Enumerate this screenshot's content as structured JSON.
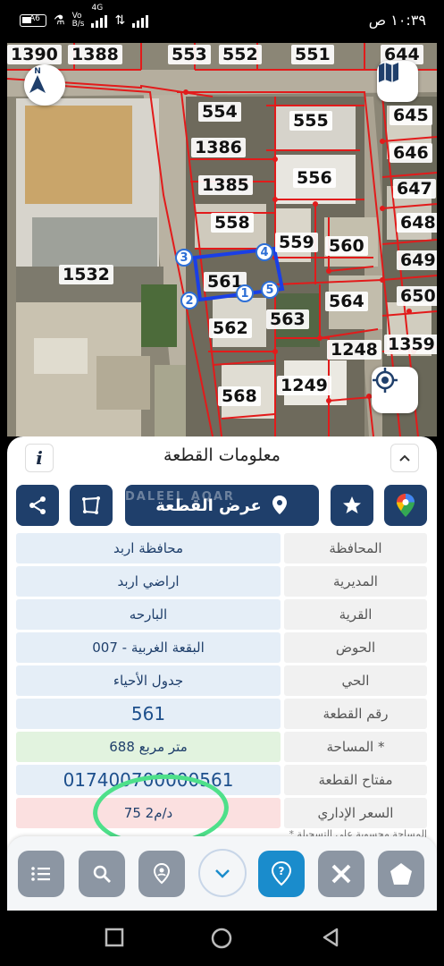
{
  "status_bar": {
    "time": "١٠:٣٩ ص",
    "battery": "A6",
    "network_speed_value": "Vo",
    "network_speed_unit": "B/s",
    "network_type": "4G"
  },
  "map": {
    "parcels": [
      {
        "id": "1390"
      },
      {
        "id": "1388"
      },
      {
        "id": "553"
      },
      {
        "id": "552"
      },
      {
        "id": "551"
      },
      {
        "id": "644"
      },
      {
        "id": "554"
      },
      {
        "id": "555"
      },
      {
        "id": "645"
      },
      {
        "id": "1386"
      },
      {
        "id": "646"
      },
      {
        "id": "1385"
      },
      {
        "id": "556"
      },
      {
        "id": "647"
      },
      {
        "id": "558"
      },
      {
        "id": "648"
      },
      {
        "id": "559"
      },
      {
        "id": "560"
      },
      {
        "id": "649"
      },
      {
        "id": "1532"
      },
      {
        "id": "561"
      },
      {
        "id": "650"
      },
      {
        "id": "564"
      },
      {
        "id": "562"
      },
      {
        "id": "563"
      },
      {
        "id": "1359"
      },
      {
        "id": "1248"
      },
      {
        "id": "568"
      },
      {
        "id": "1249"
      }
    ],
    "vertices": [
      "1",
      "2",
      "3",
      "4",
      "5"
    ],
    "selected_parcel": "561"
  },
  "panel": {
    "title": "معلومات القطعة",
    "info_icon": "i",
    "show_parcel_label": "عرض القطعة",
    "watermark": "DALEEL AQAR",
    "rows": [
      {
        "label": "المحافظة",
        "value": "محافظة اربد"
      },
      {
        "label": "المديرية",
        "value": "اراضي اربد"
      },
      {
        "label": "القرية",
        "value": "البارحه"
      },
      {
        "label": "الحوض",
        "value": "البقعة الغربية - 007"
      },
      {
        "label": "الحي",
        "value": "جدول الأحياء"
      },
      {
        "label": "رقم القطعة",
        "value": "561"
      },
      {
        "label": "المساحة *",
        "value": "688 متر مربع"
      },
      {
        "label": "مفتاح القطعة",
        "value": "017400700000561"
      },
      {
        "label": "السعر الإداري",
        "value": "75 د/م2"
      }
    ],
    "footnote": "* المساحة محسوبة على التسجيلة"
  },
  "icons": {
    "north": "north-arrow-icon",
    "map_toggle": "map-icon",
    "locate": "crosshair-icon",
    "info": "info-icon",
    "collapse": "chevron-up-icon",
    "share": "share-icon",
    "boundary": "polygon-icon",
    "pin": "location-pin-icon",
    "star": "star-icon",
    "google_maps": "google-maps-icon",
    "list": "list-icon",
    "search": "search-icon",
    "marker": "marker-icon",
    "expand": "chevron-down-icon",
    "help": "help-icon",
    "measure": "ruler-icon",
    "home": "home-icon"
  },
  "colors": {
    "primary": "#1f3f6b",
    "highlight_ring": "#4ee08a",
    "parcel_border": "#e21b1b",
    "selected_border": "#1a3fe6",
    "active_nav": "#1a8ccc",
    "row_label_bg": "#f1f1f1",
    "row_value_bg": "#e5eef7"
  }
}
